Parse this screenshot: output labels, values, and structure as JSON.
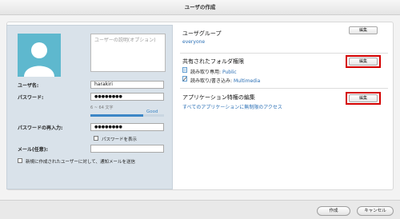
{
  "window": {
    "title": "ユーザの作成"
  },
  "user_form": {
    "description_placeholder": "ユーザーの説明(オプション)",
    "username_label": "ユーザ名:",
    "username_value": "harakiri",
    "password_label": "パスワード:",
    "password_value": "●●●●●●●●",
    "password_hint": "6 ~ 64 文字",
    "password_strength_label": "Good",
    "password_strength_level": 0.72,
    "password_confirm_label": "パスワードの再入力:",
    "password_confirm_value": "●●●●●●●●",
    "show_password_label": "パスワードを表示",
    "email_label": "メール(任意):",
    "email_value": "",
    "notify_label": "新規に作成されたユーザーに対して、通知メールを送信"
  },
  "user_group": {
    "title": "ユーザグループ",
    "value": "everyone",
    "edit_label": "編集"
  },
  "shared_folders": {
    "title": "共有されたフォルダ権限",
    "edit_label": "編集",
    "read_only_label": "読み取り専用:",
    "read_only_value": "Public",
    "read_write_label": "読み取り/書き込み:",
    "read_write_value": "Multimedia"
  },
  "app_privileges": {
    "title": "アプリケーション特権の編集",
    "value": "すべてのアプリケーションに無制限のアクセス",
    "edit_label": "編集"
  },
  "footer": {
    "create_label": "作成",
    "cancel_label": "キャンセル"
  },
  "colors": {
    "highlight": "#d40000",
    "link": "#2a6fb5",
    "avatar": "#5eb8ce"
  }
}
